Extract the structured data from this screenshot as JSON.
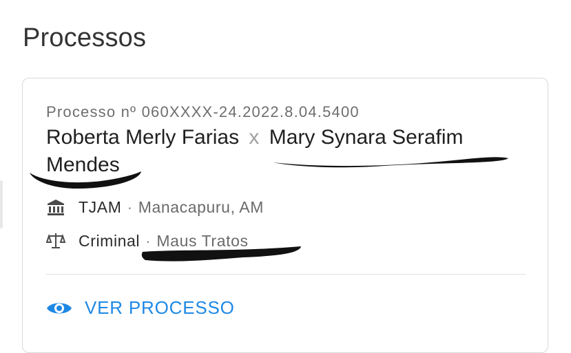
{
  "page": {
    "title": "Processos"
  },
  "case": {
    "number_label": "Processo nº 060XXXX-24.2022.8.04.5400",
    "party_a": "Roberta Merly Farias",
    "separator": "x",
    "party_b_line1": "Mary Synara Serafim",
    "party_b_line2": "Mendes",
    "court": "TJAM",
    "location": "Manacapuru, AM",
    "area": "Criminal",
    "subject": "Maus Tratos",
    "dot": "·",
    "view_label": "VER PROCESSO"
  },
  "icons": {
    "court": "bank-icon",
    "area": "scale-icon",
    "view": "eye-icon"
  },
  "colors": {
    "accent": "#1e88e5",
    "redaction": "#111111"
  }
}
